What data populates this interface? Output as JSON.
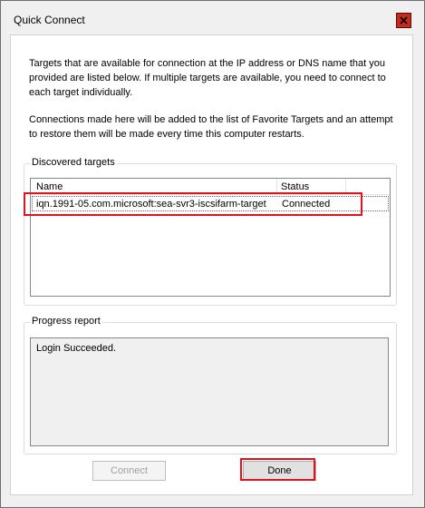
{
  "window": {
    "title": "Quick Connect"
  },
  "intro": {
    "line1": "Targets that are available for connection at the IP address or DNS name that you",
    "line2": "provided are listed below.  If multiple targets are available, you need to connect to",
    "line3": "each target individually."
  },
  "favorites_note": {
    "line1": "Connections made here will be added to the list of Favorite Targets and an attempt",
    "line2": "to restore them will be made every time this computer restarts."
  },
  "discovered": {
    "label": "Discovered targets",
    "columns": [
      "Name",
      "Status"
    ],
    "rows": [
      {
        "name": "iqn.1991-05.com.microsoft:sea-svr3-iscsifarm-target",
        "status": "Connected"
      }
    ]
  },
  "progress": {
    "label": "Progress report",
    "text": "Login Succeeded."
  },
  "buttons": {
    "connect": "Connect",
    "done": "Done"
  },
  "colors": {
    "highlight": "#e0141e",
    "close_button": "#c42b1c"
  },
  "icons": {
    "close": "close-icon"
  }
}
